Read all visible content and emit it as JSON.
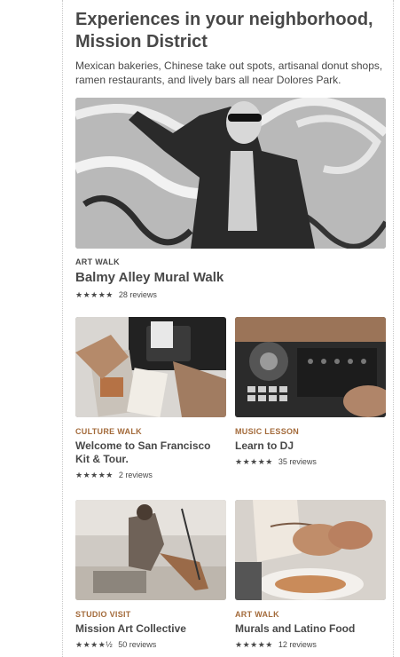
{
  "header": {
    "title": "Experiences in your neighborhood, Mission District",
    "subtitle": "Mexican bakeries, Chinese take out spots, artisanal donut shops, ramen restaurants, and lively bars all near Dolores Park."
  },
  "featured": {
    "category": "ART WALK",
    "name": "Balmy Alley Mural Walk",
    "stars": "★★★★★",
    "reviews": "28 reviews"
  },
  "experiences": [
    {
      "category": "CULTURE WALK",
      "name": "Welcome to San Francisco Kit & Tour.",
      "stars": "★★★★★",
      "reviews": "2 reviews"
    },
    {
      "category": "MUSIC LESSON",
      "name": "Learn to DJ",
      "stars": "★★★★★",
      "reviews": "35 reviews"
    },
    {
      "category": "STUDIO VISIT",
      "name": "Mission Art Collective",
      "stars": "★★★★½",
      "reviews": "50 reviews"
    },
    {
      "category": "ART WALK",
      "name": "Murals and Latino Food",
      "stars": "★★★★★",
      "reviews": "12 reviews"
    }
  ],
  "colors": {
    "text": "#484848",
    "accent": "#a36a3a"
  }
}
